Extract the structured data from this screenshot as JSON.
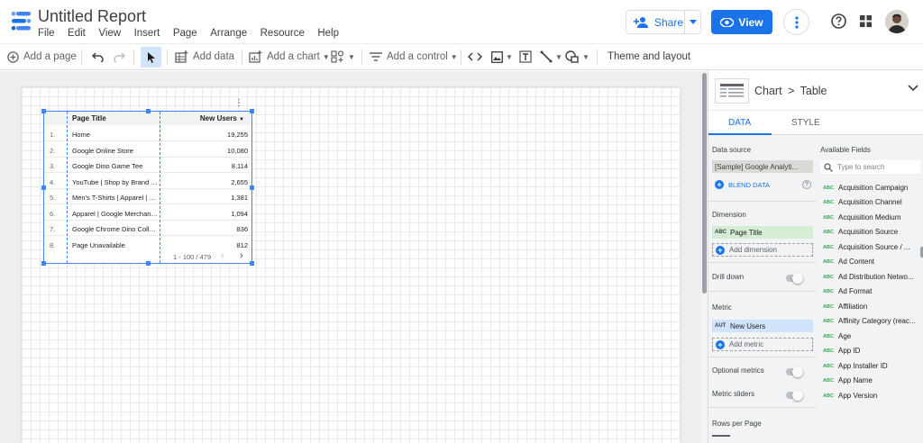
{
  "app": {
    "title": "Untitled Report",
    "menu": [
      "File",
      "Edit",
      "View",
      "Insert",
      "Page",
      "Arrange",
      "Resource",
      "Help"
    ],
    "share_label": "Share",
    "view_label": "View",
    "accent": "#1a73e8"
  },
  "toolbar": {
    "add_page": "Add a page",
    "add_data": "Add data",
    "add_chart": "Add a chart",
    "add_control": "Add a control",
    "theme": "Theme and layout"
  },
  "table": {
    "headers": [
      "Page Title",
      "New Users"
    ],
    "rows": [
      {
        "idx": "1.",
        "name": "Home",
        "value": "19,255"
      },
      {
        "idx": "2.",
        "name": "Google Online Store",
        "value": "10,080"
      },
      {
        "idx": "3.",
        "name": "Google Dino Game Tee",
        "value": "8,114"
      },
      {
        "idx": "4.",
        "name": "YouTube | Shop by Brand | ...",
        "value": "2,655"
      },
      {
        "idx": "5.",
        "name": "Men's T-Shirts | Apparel | G...",
        "value": "1,381"
      },
      {
        "idx": "6.",
        "name": "Apparel | Google Merchand...",
        "value": "1,094"
      },
      {
        "idx": "7.",
        "name": "Google Chrome Dino Colle...",
        "value": "836"
      },
      {
        "idx": "8.",
        "name": "Page Unavailable",
        "value": "812"
      }
    ],
    "pagination": "1 - 100 / 479"
  },
  "panel": {
    "breadcrumb_chart": "Chart",
    "breadcrumb_sep": ">",
    "breadcrumb_type": "Table",
    "tab_data": "DATA",
    "tab_style": "STYLE",
    "data_source_label": "Data source",
    "data_source_value": "[Sample] Google Analyti...",
    "blend_label": "BLEND DATA",
    "dimension_label": "Dimension",
    "dimension_tag": "ABC",
    "dimension_value": "Page Title",
    "add_dimension": "Add dimension",
    "drill_down": "Drill down",
    "metric_label": "Metric",
    "metric_tag": "AUT",
    "metric_value": "New Users",
    "add_metric": "Add metric",
    "optional_metrics": "Optional metrics",
    "metric_sliders": "Metric sliders",
    "rows_per_page": "Rows per Page",
    "available_fields_label": "Available Fields",
    "search_placeholder": "Type to search",
    "field_tag": "ABC",
    "fields": [
      "Acquisition Campaign",
      "Acquisition Channel",
      "Acquisition Medium",
      "Acquisition Source",
      "Acquisition Source / ...",
      "Ad Content",
      "Ad Distribution Netwo...",
      "Ad Format",
      "Affiliation",
      "Affinity Category (reac...",
      "Age",
      "App ID",
      "App Installer ID",
      "App Name",
      "App Version"
    ]
  }
}
